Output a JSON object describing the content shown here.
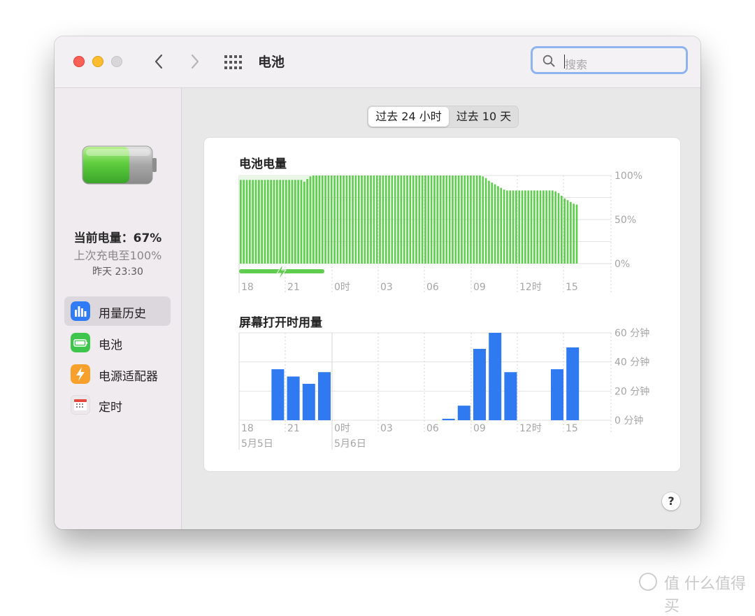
{
  "window": {
    "title": "电池",
    "search_placeholder": "搜索"
  },
  "sidebar": {
    "current_level": "当前电量：67%",
    "last_charged": "上次充电至100%",
    "last_charged_time": "昨天 23:30",
    "items": [
      {
        "label": "用量历史",
        "icon": "bar-chart-icon",
        "color": "#2f7cf6",
        "active": true
      },
      {
        "label": "电池",
        "icon": "battery-icon",
        "color": "#3ec64c",
        "active": false
      },
      {
        "label": "电源适配器",
        "icon": "lightning-bolt-icon",
        "color": "#f7a02b",
        "active": false
      },
      {
        "label": "定时",
        "icon": "calendar-icon",
        "color": "#e8e4e8",
        "active": false
      }
    ]
  },
  "segmented": {
    "options": [
      "过去 24 小时",
      "过去 10 天"
    ],
    "selected": 0
  },
  "help_label": "?",
  "watermark": "值 什么值得买",
  "colors": {
    "battery_green": "#5fce4f",
    "charging_green": "#5fce4f",
    "screen_blue": "#2f79f1",
    "grid": "#e2e2e2",
    "axis_text": "#a5a5a5"
  },
  "chart_data": [
    {
      "type": "bar",
      "title": "电池电量",
      "x_tick_labels": [
        "18",
        "21",
        "0时",
        "03",
        "06",
        "09",
        "12时",
        "15"
      ],
      "y_tick_labels": [
        "100%",
        "50%",
        "0%"
      ],
      "ylim": [
        0,
        100
      ],
      "charging_period": "18 – 23:30",
      "values": [
        95,
        95,
        95,
        95,
        95,
        95,
        95,
        95,
        95,
        95,
        95,
        95,
        95,
        95,
        95,
        95,
        95,
        95,
        95,
        95,
        95,
        93,
        96,
        99,
        100,
        100,
        100,
        100,
        100,
        100,
        100,
        100,
        100,
        100,
        100,
        100,
        100,
        100,
        100,
        100,
        100,
        100,
        100,
        100,
        100,
        100,
        100,
        100,
        100,
        100,
        100,
        100,
        100,
        100,
        100,
        100,
        100,
        100,
        100,
        100,
        100,
        100,
        100,
        100,
        100,
        100,
        100,
        100,
        100,
        100,
        100,
        100,
        100,
        100,
        100,
        100,
        100,
        100,
        100,
        100,
        99,
        97,
        94,
        92,
        90,
        88,
        86,
        84,
        83,
        83,
        83,
        83,
        83,
        83,
        83,
        83,
        83,
        83,
        83,
        83,
        83,
        83,
        83,
        83,
        82,
        80,
        77,
        74,
        72,
        70,
        68,
        67
      ]
    },
    {
      "type": "bar",
      "title": "屏幕打开时用量",
      "x_tick_labels": [
        "18",
        "21",
        "0时",
        "03",
        "06",
        "09",
        "12时",
        "15"
      ],
      "date_labels": [
        "5月5日",
        "5月6日"
      ],
      "y_tick_labels": [
        "60 分钟",
        "40 分钟",
        "20 分钟",
        "0 分钟"
      ],
      "ylim": [
        0,
        60
      ],
      "categories": [
        "18",
        "19",
        "20",
        "21",
        "22",
        "23",
        "0",
        "1",
        "2",
        "3",
        "4",
        "5",
        "6",
        "7",
        "8",
        "9",
        "10",
        "11",
        "12",
        "13",
        "14",
        "15"
      ],
      "values": [
        0,
        0,
        35,
        30,
        25,
        33,
        0,
        0,
        0,
        0,
        0,
        0,
        0,
        1,
        10,
        49,
        60,
        33,
        0,
        0,
        35,
        50
      ]
    }
  ]
}
